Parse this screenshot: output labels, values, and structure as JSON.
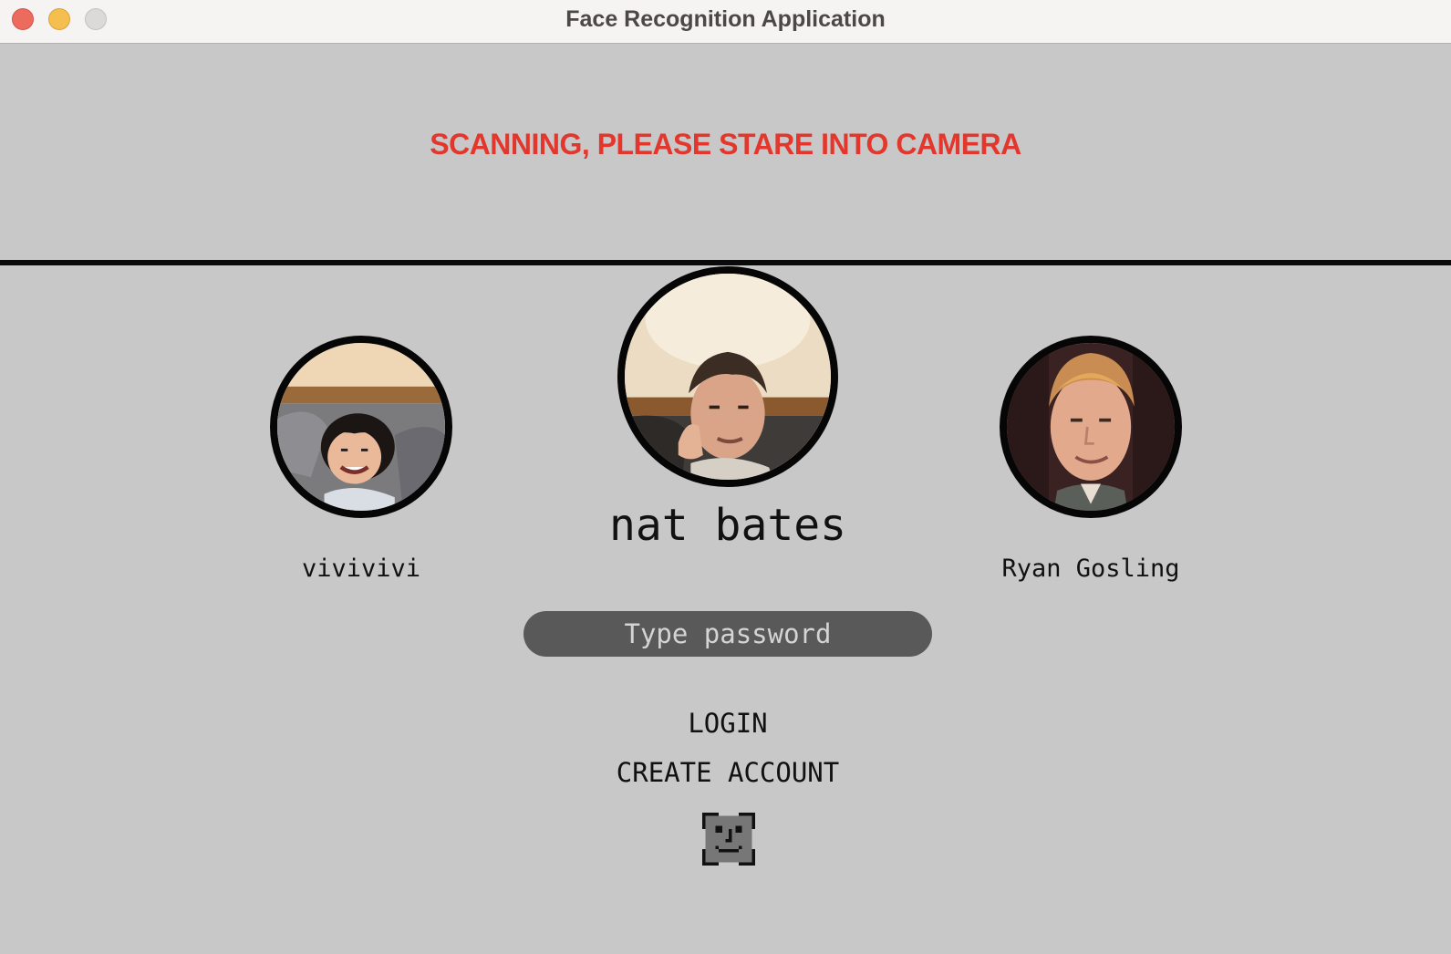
{
  "window": {
    "title": "Face Recognition Application",
    "controls": [
      "close",
      "minimize",
      "zoom"
    ]
  },
  "status": {
    "message": "SCANNING, PLEASE STARE INTO CAMERA",
    "color": "#e3372d"
  },
  "profiles": {
    "left": {
      "name": "vivivivi"
    },
    "center": {
      "name": "nat bates",
      "selected": true
    },
    "right": {
      "name": "Ryan Gosling"
    }
  },
  "password": {
    "placeholder": "Type password",
    "value": ""
  },
  "actions": {
    "login_label": "LOGIN",
    "create_account_label": "CREATE ACCOUNT",
    "face_scan_icon": "face-id-icon"
  },
  "colors": {
    "background": "#c8c8c8",
    "input_background": "#595959",
    "divider": "#0a0a0a"
  }
}
